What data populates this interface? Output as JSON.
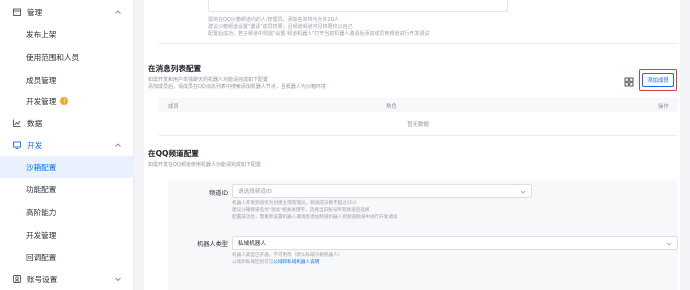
{
  "sidebar": {
    "items": [
      {
        "label": "管理",
        "kind": "group",
        "icon": "box-icon"
      },
      {
        "label": "发布上架",
        "kind": "child"
      },
      {
        "label": "使用范围和人员",
        "kind": "child"
      },
      {
        "label": "成员管理",
        "kind": "child"
      },
      {
        "label": "开发管理",
        "kind": "child",
        "badge": "!"
      },
      {
        "label": "数据",
        "kind": "group",
        "icon": "chart-icon"
      },
      {
        "label": "开发",
        "kind": "group",
        "icon": "monitor-icon"
      },
      {
        "label": "沙箱配置",
        "kind": "child"
      },
      {
        "label": "功能配置",
        "kind": "child"
      },
      {
        "label": "高阶能力",
        "kind": "child"
      },
      {
        "label": "开发管理",
        "kind": "child"
      },
      {
        "label": "回调配置",
        "kind": "child"
      },
      {
        "label": "账号设置",
        "kind": "group",
        "icon": "account-icon"
      }
    ]
  },
  "top_section": {
    "lines": [
      "需将在QQ沙箱频道内的人/管理员，添加名单将与允许20人",
      "建议沙箱频道设置\"邀请\"成员权限，且频道频道可见权限仅以自己",
      "配置后成功，若子频道中则需\"设置-频道机器人\"打开当前机器人邀请后添加成员到频道进行开发调试"
    ]
  },
  "message_list": {
    "title": "在消息列表配置",
    "desc_1": "如需开发和用户单独聊天的机器人功能请完成如下配置",
    "desc_2": "添加成员后，请成员在QQ消息列表中搜索添加机器人节点，且机器人为沙箱环境",
    "add_button": "添加成员",
    "columns": [
      "成员",
      "角色",
      "操作"
    ],
    "empty_text": "暂无数据"
  },
  "qq_channel": {
    "title": "在QQ频道配置",
    "desc": "如需开发在QQ频道使用机器人功能请完成如下配置",
    "channel_label": "频道ID",
    "channel_placeholder": "请选择频道ID",
    "channel_hints": [
      "机器人开发频道仅为创建主或管理员，频道成员数不超过20人",
      "建议沙箱频道名为\"测试\"相关关键字，选择当前账号所有频道后选择",
      "配置成功后，需重新设置机器人邀请后添加频道机器人到频道频道中进行开发调试"
    ],
    "bot_type_label": "机器人类型",
    "bot_type_value": "私域机器人",
    "bot_type_hint": "机器人类型已开通，不可更改（默认私域沙箱机器人）",
    "bot_type_link_prefix": "公域和私域区别可见",
    "bot_type_link": "公域和私域机器人说明"
  },
  "colors": {
    "accent": "#0d6efd",
    "highlight_border": "#e23b3b",
    "badge": "#f5a623"
  }
}
